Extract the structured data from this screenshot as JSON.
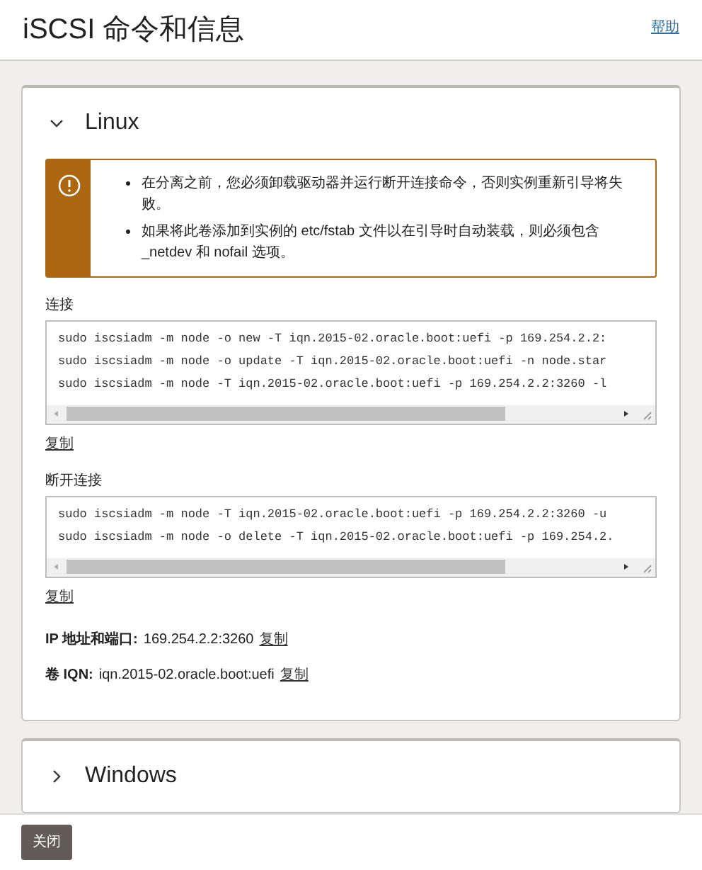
{
  "header": {
    "title": "iSCSI 命令和信息",
    "help_link": "帮助"
  },
  "sections": [
    {
      "title": "Linux",
      "expanded": true,
      "warning": [
        "在分离之前，您必须卸载驱动器并运行断开连接命令，否则实例重新引导将失败。",
        "如果将此卷添加到实例的 etc/fstab 文件以在引导时自动装载，则必须包含 _netdev 和 nofail 选项。"
      ],
      "command_groups": [
        {
          "label": "连接",
          "lines": [
            "sudo iscsiadm -m node -o new -T iqn.2015-02.oracle.boot:uefi -p 169.254.2.2:",
            "sudo iscsiadm -m node -o update -T iqn.2015-02.oracle.boot:uefi -n node.star",
            "sudo iscsiadm -m node -T iqn.2015-02.oracle.boot:uefi -p 169.254.2.2:3260 -l"
          ],
          "copy": "复制"
        },
        {
          "label": "断开连接",
          "lines": [
            "sudo iscsiadm -m node -T iqn.2015-02.oracle.boot:uefi -p 169.254.2.2:3260 -u",
            "sudo iscsiadm -m node -o delete -T iqn.2015-02.oracle.boot:uefi -p 169.254.2."
          ],
          "copy": "复制"
        }
      ],
      "info": [
        {
          "label": "IP 地址和端口:",
          "value": "169.254.2.2:3260",
          "copy": "复制"
        },
        {
          "label": "卷 IQN:",
          "value": "iqn.2015-02.oracle.boot:uefi",
          "copy": "复制"
        }
      ]
    },
    {
      "title": "Windows",
      "expanded": false
    }
  ],
  "footer": {
    "close_button": "关闭"
  }
}
